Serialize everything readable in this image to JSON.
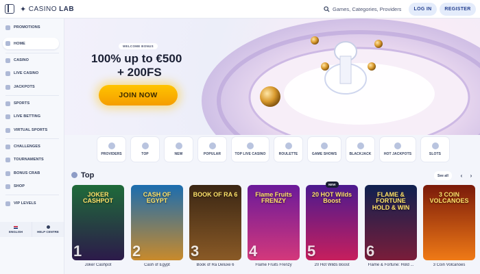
{
  "header": {
    "brand_prefix": "CASINO",
    "brand_suffix": "LAB",
    "search_placeholder": "Games, Categories, Providers",
    "login_label": "LOG IN",
    "register_label": "REGISTER"
  },
  "sidebar": {
    "items": [
      {
        "label": "PROMOTIONS",
        "icon": "gift-icon"
      },
      {
        "label": "HOME",
        "icon": "home-icon",
        "active": true
      },
      {
        "label": "CASINO",
        "icon": "cards-icon"
      },
      {
        "label": "LIVE CASINO",
        "icon": "live-icon"
      },
      {
        "label": "JACKPOTS",
        "icon": "jackpot-icon"
      },
      {
        "label": "SPORTS",
        "icon": "ball-icon"
      },
      {
        "label": "LIVE BETTING",
        "icon": "stopwatch-icon"
      },
      {
        "label": "VIRTUAL SPORTS",
        "icon": "virtual-icon"
      },
      {
        "label": "CHALLENGES",
        "icon": "trophy-icon"
      },
      {
        "label": "TOURNAMENTS",
        "icon": "tournament-icon"
      },
      {
        "label": "BONUS CRAB",
        "icon": "crab-icon"
      },
      {
        "label": "SHOP",
        "icon": "shop-icon"
      },
      {
        "label": "VIP LEVELS",
        "icon": "crown-icon"
      }
    ],
    "language_label": "ENGLISH",
    "help_label": "HELP CENTRE"
  },
  "hero": {
    "badge": "WELCOME BONUS",
    "title_line1": "100% up to €500",
    "title_line2": "+ 200FS",
    "cta_label": "JOIN NOW"
  },
  "categories": [
    {
      "label": "PROVIDERS"
    },
    {
      "label": "TOP"
    },
    {
      "label": "NEW"
    },
    {
      "label": "POPULAR"
    },
    {
      "label": "TOP LIVE CASINO"
    },
    {
      "label": "ROULETTE"
    },
    {
      "label": "GAME SHOWS"
    },
    {
      "label": "BLACKJACK"
    },
    {
      "label": "HOT JACKPOTS"
    },
    {
      "label": "SLOTS"
    }
  ],
  "top_section": {
    "title": "Top",
    "see_all_label": "See all",
    "prev_arrow": "‹",
    "next_arrow": "›",
    "new_badge": "NEW",
    "games": [
      {
        "name": "Joker Cashpot",
        "art_title": "JOKER CASHPOT",
        "rank": "1",
        "bg": [
          "#1f6b3a",
          "#2c1a4a"
        ]
      },
      {
        "name": "Cash of Egypt",
        "art_title": "CASH OF EGYPT",
        "rank": "2",
        "bg": [
          "#1b6db0",
          "#c98a2b"
        ]
      },
      {
        "name": "Book of Ra Deluxe 6",
        "art_title": "BOOK OF RA 6",
        "rank": "3",
        "bg": [
          "#3a2614",
          "#8a5a26"
        ]
      },
      {
        "name": "Flame Fruits Frenzy",
        "art_title": "Flame Fruits FRENZY",
        "rank": "4",
        "bg": [
          "#6a1a9a",
          "#d4387b"
        ]
      },
      {
        "name": "20 Hot Wilds Boost",
        "art_title": "20 HOT Wilds Boost",
        "rank": "5",
        "bg": [
          "#4b1a8f",
          "#c71f5d"
        ]
      },
      {
        "name": "Flame & Fortune: Hold ...",
        "art_title": "FLAME & FORTUNE HOLD & WIN",
        "rank": "6",
        "bg": [
          "#0f2150",
          "#7a1d3a"
        ]
      },
      {
        "name": "3 Coin Volcanoes",
        "art_title": "3 COIN VOLCANOES",
        "rank": "",
        "bg": [
          "#7a1a0a",
          "#f07a16"
        ]
      }
    ]
  }
}
